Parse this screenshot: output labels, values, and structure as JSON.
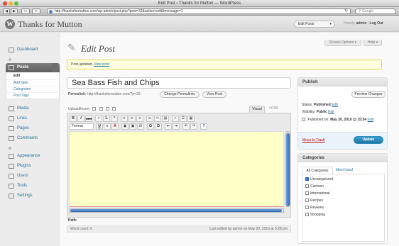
{
  "browser": {
    "window_title": "Edit Post ‹ Thanks for Mutton — WordPress",
    "url": "http://thanksformutton.com/wp-admin/post.php?post=32&action=edit&message=1",
    "search_placeholder": "Google",
    "back_label": "◀",
    "forward_label": "▶",
    "add_label": "+",
    "reload_glyph": "↻"
  },
  "header": {
    "logo_letter": "W",
    "site_title": "Thanks for Mutton",
    "favorite_actions": "Edit Posts",
    "favorite_arrow": "▾",
    "howdy_prefix": "Howdy,",
    "username": "admin",
    "separator": "|",
    "logout": "Log Out"
  },
  "sidebar": {
    "dashboard": "Dashboard",
    "posts": "Posts",
    "posts_submenu": [
      "Edit",
      "Add New",
      "Categories",
      "Post Tags"
    ],
    "media": "Media",
    "links": "Links",
    "pages": "Pages",
    "comments": "Comments",
    "appearance": "Appearance",
    "plugins": "Plugins",
    "users": "Users",
    "tools": "Tools",
    "settings": "Settings"
  },
  "main": {
    "screen_options": "Screen Options ▾",
    "help": "Help ▾",
    "page_title": "Edit Post",
    "notice_text": "Post updated.",
    "notice_link": "View post",
    "post_title": "Sea Bass Fish and Chips",
    "permalink_label": "Permalink:",
    "permalink_url": "http://thanksformutton.com/?p=32",
    "change_permalinks": "Change Permalinks",
    "view_post": "View Post",
    "upload_insert": "Upload/Insert",
    "tab_visual": "Visual",
    "tab_html": "HTML",
    "format_select": "Format",
    "path_label": "Path:",
    "word_count": "Word count: 0",
    "last_edited": "Last edited by admin on May 20, 2010 at 3:29 pm"
  },
  "toolbar_row1": [
    "B",
    "I",
    "ABC",
    "•",
    "1.",
    "“",
    "≡",
    "≡",
    "≡",
    "∞",
    "✂",
    "▤",
    "✓",
    "☰",
    "▦"
  ],
  "toolbar_row2": [
    "U",
    "≡",
    "A",
    "▣",
    "▣",
    "∅",
    "Ω",
    "Ω",
    "⇤",
    "⇥",
    "↶",
    "↷",
    "?"
  ],
  "publish": {
    "heading": "Publish",
    "preview_changes": "Preview Changes",
    "status_label": "Status:",
    "status_value": "Published",
    "visibility_label": "Visibility:",
    "visibility_value": "Public",
    "edit_link": "Edit",
    "published_on_label": "Published on:",
    "published_on_value": "May 20, 2010 @ 15:54",
    "move_to_trash": "Move to Trash",
    "update": "Update"
  },
  "categories": {
    "heading": "Categories",
    "tab_all": "All Categories",
    "tab_most_used": "Most Used",
    "items": [
      {
        "label": "Uncategorized",
        "checked": true
      },
      {
        "label": "Canteen",
        "checked": false
      },
      {
        "label": "International",
        "checked": false
      },
      {
        "label": "Recipes",
        "checked": false
      },
      {
        "label": "Reviews",
        "checked": false
      },
      {
        "label": "Shopping",
        "checked": false
      }
    ]
  },
  "colors": {
    "link": "#21759b",
    "notice_bg": "#ffffe0",
    "editor_bg": "#ffffc8",
    "update_button": "#21759b",
    "trash_link": "#bb0000"
  }
}
